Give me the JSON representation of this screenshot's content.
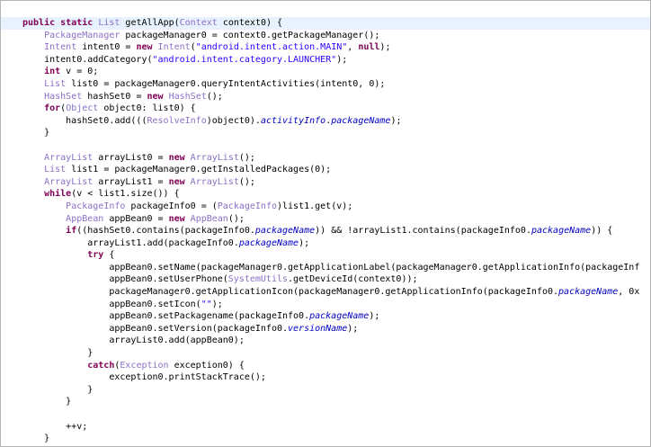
{
  "editor": {
    "lines": [
      "public static List getAllApp(Context context0) {",
      "    PackageManager packageManager0 = context0.getPackageManager();",
      "    Intent intent0 = new Intent(\"android.intent.action.MAIN\", null);",
      "    intent0.addCategory(\"android.intent.category.LAUNCHER\");",
      "    int v = 0;",
      "    List list0 = packageManager0.queryIntentActivities(intent0, 0);",
      "    HashSet hashSet0 = new HashSet();",
      "    for(Object object0: list0) {",
      "        hashSet0.add(((ResolveInfo)object0).activityInfo.packageName);",
      "    }",
      "",
      "    ArrayList arrayList0 = new ArrayList();",
      "    List list1 = packageManager0.getInstalledPackages(0);",
      "    ArrayList arrayList1 = new ArrayList();",
      "    while(v < list1.size()) {",
      "        PackageInfo packageInfo0 = (PackageInfo)list1.get(v);",
      "        AppBean appBean0 = new AppBean();",
      "        if((hashSet0.contains(packageInfo0.packageName)) && !arrayList1.contains(packageInfo0.packageName)) {",
      "            arrayList1.add(packageInfo0.packageName);",
      "            try {",
      "                appBean0.setName(packageManager0.getApplicationLabel(packageManager0.getApplicationInfo(packageInf",
      "                appBean0.setUserPhone(SystemUtils.getDeviceId(context0));",
      "                packageManager0.getApplicationIcon(packageManager0.getApplicationInfo(packageInfo0.packageName, 0x",
      "                appBean0.setIcon(\"\");",
      "                appBean0.setPackagename(packageInfo0.packageName);",
      "                appBean0.setVersion(packageInfo0.versionName);",
      "                arrayList0.add(appBean0);",
      "            }",
      "            catch(Exception exception0) {",
      "                exception0.printStackTrace();",
      "            }",
      "        }",
      "",
      "        ++v;",
      "    }"
    ]
  }
}
